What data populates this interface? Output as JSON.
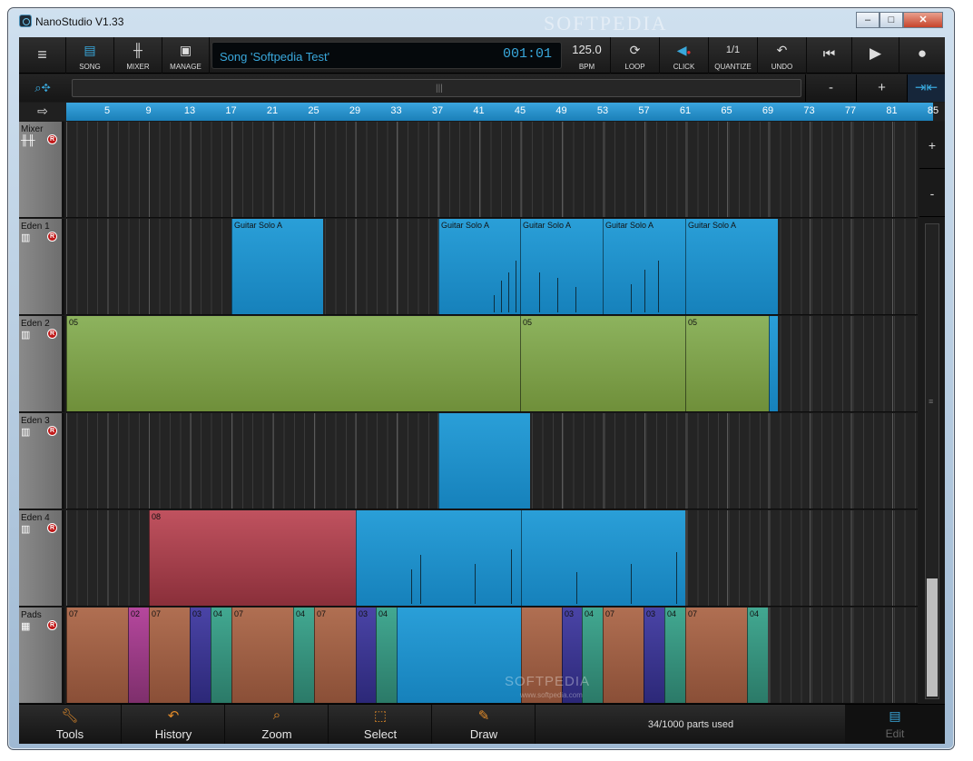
{
  "window": {
    "title": "NanoStudio V1.33",
    "watermark_top": "SOFTPEDIA"
  },
  "toolbar": {
    "menu_label": "",
    "song": "SONG",
    "mixer": "MIXER",
    "manage": "MANAGE",
    "song_name": "Song 'Softpedia Test'",
    "time": "001:01",
    "bpm_value": "125.0",
    "bpm": "BPM",
    "loop": "LOOP",
    "click": "CLICK",
    "quantize_value": "1/1",
    "quantize": "QUANTIZE",
    "undo": "UNDO"
  },
  "zoom": {
    "minus": "-",
    "plus": "+"
  },
  "ruler": {
    "ticks": [
      "5",
      "9",
      "13",
      "17",
      "21",
      "25",
      "29",
      "33",
      "37",
      "41",
      "45",
      "49",
      "53",
      "57",
      "61",
      "65",
      "69",
      "73",
      "77",
      "81",
      "85"
    ]
  },
  "tracks": [
    {
      "name": "Mixer",
      "icon": "mixer-icon"
    },
    {
      "name": "Eden 1",
      "icon": "keyboard-icon"
    },
    {
      "name": "Eden 2",
      "icon": "keyboard-icon"
    },
    {
      "name": "Eden 3",
      "icon": "keyboard-icon"
    },
    {
      "name": "Eden 4",
      "icon": "keyboard-icon"
    },
    {
      "name": "Pads",
      "icon": "pads-grid-icon"
    }
  ],
  "rec_label": "R",
  "parts": {
    "eden1": [
      "Guitar Solo A",
      "Guitar Solo A",
      "Guitar Solo A",
      "Guitar Solo A",
      "Guitar Solo A"
    ],
    "eden2": [
      "05",
      "05",
      "05"
    ],
    "eden4": [
      "08"
    ],
    "pads": [
      "07",
      "02",
      "07",
      "03",
      "04",
      "07",
      "04",
      "07",
      "03",
      "04",
      "03",
      "04",
      "07",
      "03",
      "04",
      "07",
      "04"
    ]
  },
  "right_panel": {
    "plus": "+",
    "minus": "-"
  },
  "bottom": {
    "tools": "Tools",
    "history": "History",
    "zoom": "Zoom",
    "select": "Select",
    "draw": "Draw",
    "parts_used": "34/1000 parts used",
    "edit": "Edit"
  },
  "watermark": {
    "main": "SOFTPEDIA",
    "url": "www.softpedia.com"
  },
  "colors": {
    "accent": "#2a9fd8",
    "green": "#8db35e",
    "red": "#c0525f",
    "brown": "#b06f52",
    "purple": "#b5479d",
    "indigo": "#4a44a6",
    "teal": "#42a891"
  }
}
